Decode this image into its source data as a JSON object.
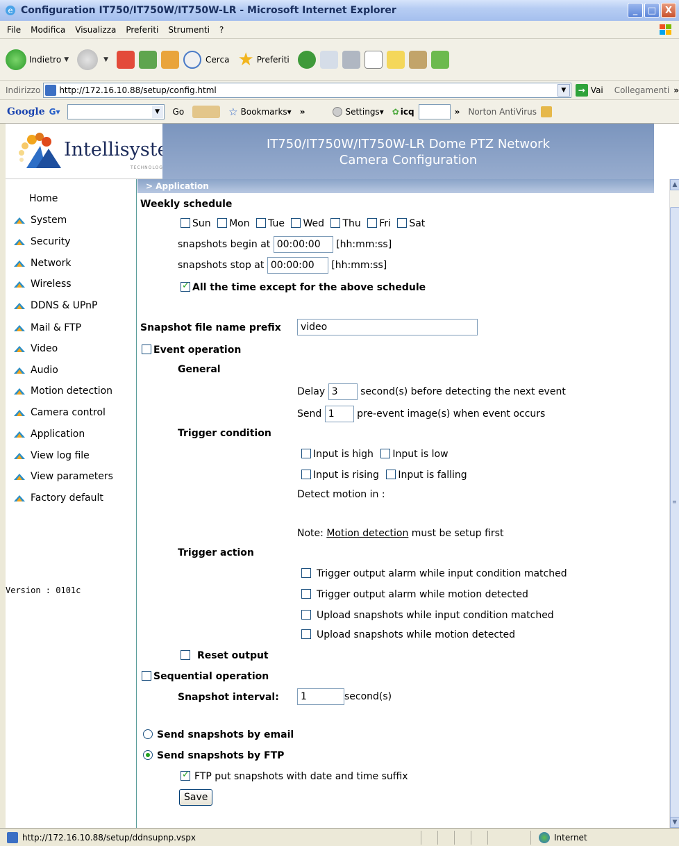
{
  "window": {
    "title": "Configuration IT750/IT750W/IT750W-LR - Microsoft Internet Explorer",
    "controls": [
      "_",
      "□",
      "X"
    ]
  },
  "menu": [
    "File",
    "Modifica",
    "Visualizza",
    "Preferiti",
    "Strumenti",
    "?"
  ],
  "toolbar": {
    "back_label": "Indietro",
    "search_label": "Cerca",
    "favorites_label": "Preferiti"
  },
  "address": {
    "label": "Indirizzo",
    "url": "http://172.16.10.88/setup/config.html",
    "go_label": "Vai",
    "links_label": "Collegamenti",
    "more": "»"
  },
  "googlebar": {
    "logo": "Google",
    "g": "G▾",
    "go_label": "Go",
    "bookmarks_label": "Bookmarks▾",
    "settings_label": "Settings▾",
    "icq_label": "icq",
    "more": "»",
    "norton_label": "Norton AntiVirus"
  },
  "brand": {
    "name": "Intellisystem",
    "tagline": "TECHNOLOGIES",
    "header_line1": "IT750/IT750W/IT750W-LR Dome PTZ Network",
    "header_line2": "Camera Configuration"
  },
  "sidebar": {
    "home": "Home",
    "items": [
      "System",
      "Security",
      "Network",
      "Wireless",
      "DDNS & UPnP",
      "Mail & FTP",
      "Video",
      "Audio",
      "Motion detection",
      "Camera control",
      "Application",
      "View log file",
      "View parameters",
      "Factory default"
    ],
    "version": "Version : 0101c"
  },
  "section": "> Application",
  "schedule": {
    "heading": "Weekly schedule",
    "days": [
      "Sun",
      "Mon",
      "Tue",
      "Wed",
      "Thu",
      "Fri",
      "Sat"
    ],
    "begin_label": "snapshots begin at",
    "begin_value": "00:00:00",
    "stop_label": "snapshots stop at",
    "stop_value": "00:00:00",
    "format_hint": "[hh:mm:ss]",
    "except_label": "All the time except for the above schedule",
    "except_checked": true
  },
  "prefix": {
    "label": "Snapshot file name prefix",
    "value": "video"
  },
  "event": {
    "label": "Event operation",
    "checked": false,
    "general_heading": "General",
    "delay_label": "Delay",
    "delay_value": "3",
    "delay_suffix": "second(s) before detecting the next event",
    "send_label": "Send",
    "send_value": "1",
    "send_suffix": "pre-event image(s) when event occurs",
    "trigger_condition_heading": "Trigger condition",
    "cond_high": "Input is high",
    "cond_low": "Input is low",
    "cond_rising": "Input is rising",
    "cond_falling": "Input is falling",
    "detect_motion": "Detect motion in :",
    "note_prefix": "Note: ",
    "note_link": "Motion detection",
    "note_suffix": " must be setup first",
    "trigger_action_heading": "Trigger action",
    "actions": [
      "Trigger output alarm while input condition matched",
      "Trigger output alarm while motion detected",
      "Upload snapshots while input condition matched",
      "Upload snapshots while motion detected"
    ],
    "reset_output": "Reset output"
  },
  "sequential": {
    "label": "Sequential operation",
    "checked": false,
    "interval_label": "Snapshot interval:",
    "interval_value": "1",
    "interval_suffix": "second(s)"
  },
  "delivery": {
    "email_label": "Send snapshots by email",
    "ftp_label": "Send snapshots by FTP",
    "selected": "ftp",
    "ftp_suffix_label": "FTP put snapshots with date and time suffix",
    "ftp_suffix_checked": true
  },
  "save_label": "Save",
  "status": {
    "url": "http://172.16.10.88/setup/ddnsupnp.vspx",
    "zone": "Internet"
  },
  "colors": {
    "header_bg": "#8aa3c8",
    "sidebar_border": "#5a9d9a",
    "check_green": "#21a121"
  }
}
